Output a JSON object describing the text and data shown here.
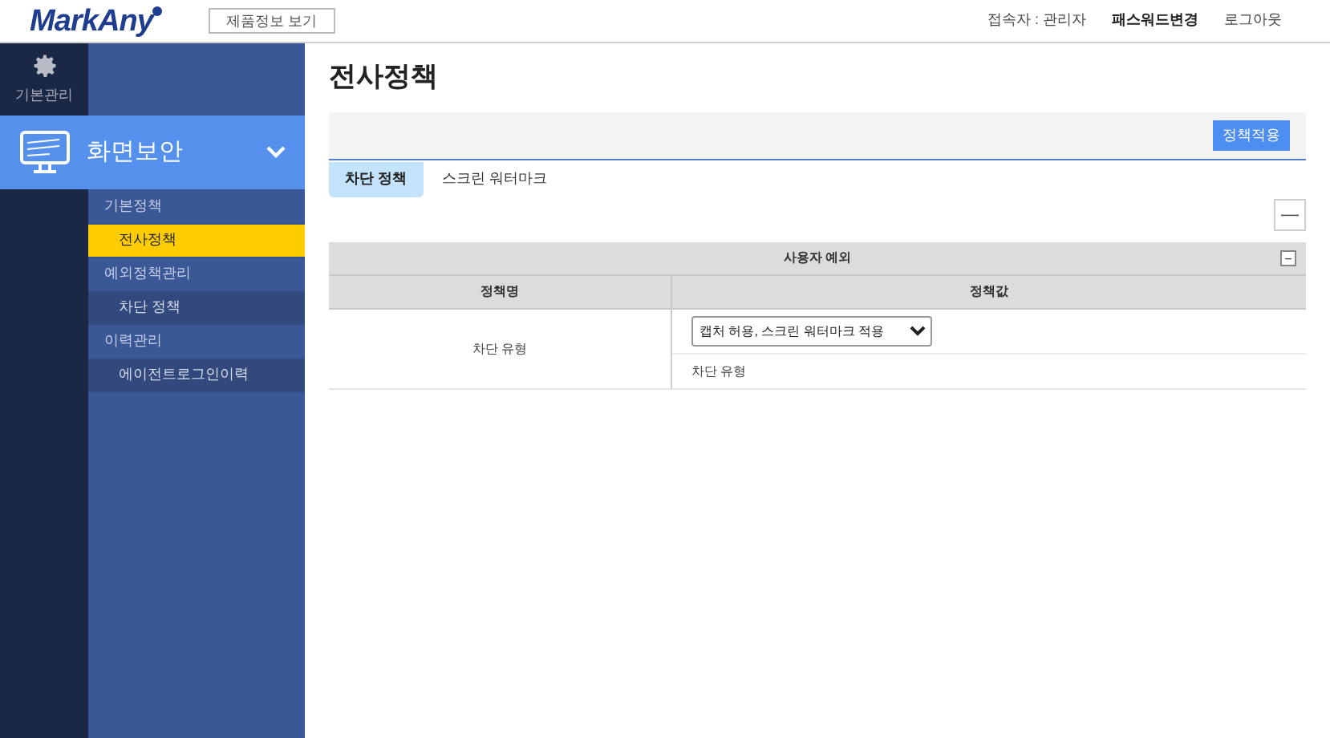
{
  "header": {
    "logo": "MarkAny",
    "product_info_button": "제품정보 보기",
    "user_label": "접속자 : 관리자",
    "password_link": "패스워드변경",
    "logout_link": "로그아웃"
  },
  "rail": [
    {
      "label": "기본관리",
      "selected": false
    }
  ],
  "section": {
    "label": "화면보안",
    "expanded": true
  },
  "menu": [
    {
      "label": "기본정책",
      "selected": false,
      "children": [
        {
          "label": "전사정책",
          "selected": true
        }
      ]
    },
    {
      "label": "예외정책관리",
      "selected": false,
      "children": [
        {
          "label": "차단 정책",
          "selected": false
        }
      ]
    },
    {
      "label": "이력관리",
      "selected": false,
      "children": [
        {
          "label": "에이전트로그인이력",
          "selected": false
        }
      ]
    }
  ],
  "page_title": "전사정책",
  "apply_button": "정책적용",
  "tabs": [
    {
      "label": "차단 정책",
      "selected": true
    },
    {
      "label": "스크린 워터마크",
      "selected": false
    }
  ],
  "collapse_button": "—",
  "table": {
    "title": "사용자 예외",
    "title_toggle": "−",
    "columns": [
      "정책명",
      "정책값"
    ],
    "rows": [
      {
        "name": "차단 유형",
        "select_value": "캡처 허용, 스크린 워터마크 적용",
        "description": "차단 유형"
      }
    ]
  }
}
